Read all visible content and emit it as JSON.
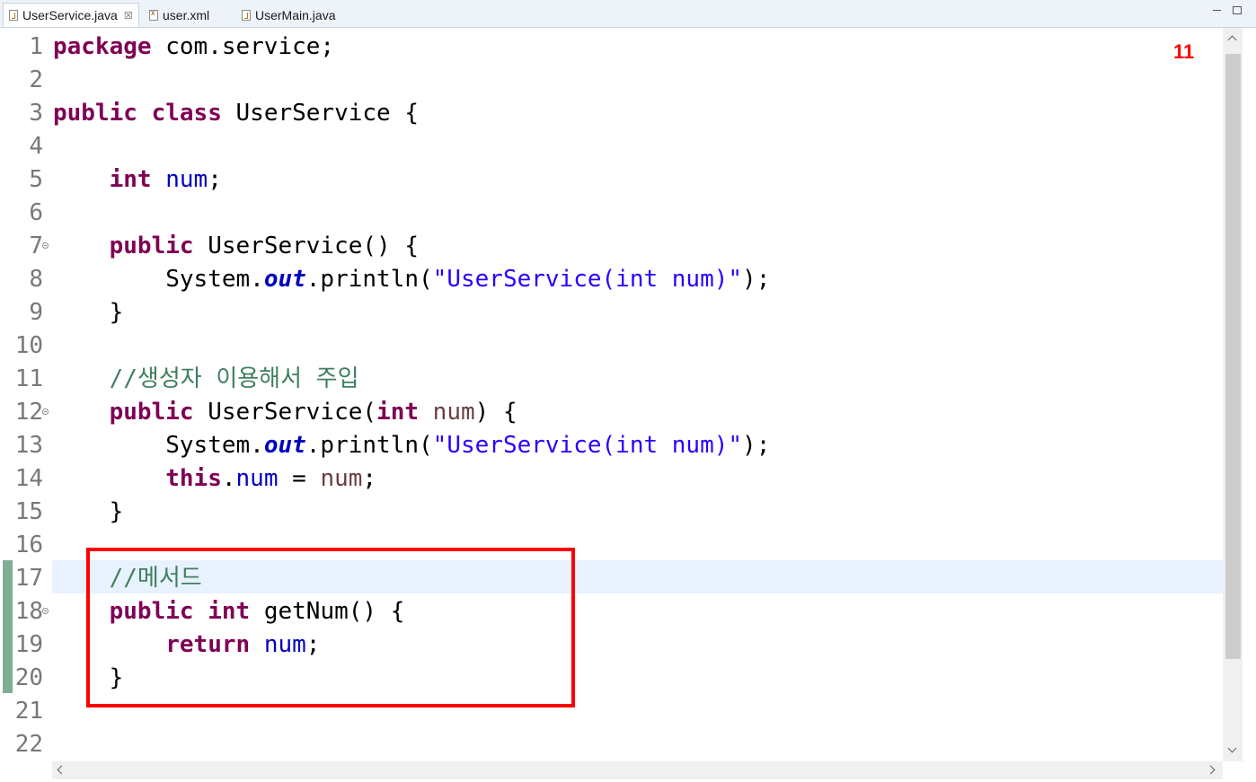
{
  "tabs": [
    {
      "label": "UserService.java",
      "icon": "java-file-icon",
      "active": true,
      "close": "☒"
    },
    {
      "label": "user.xml",
      "icon": "xml-file-icon",
      "active": false
    },
    {
      "label": "UserMain.java",
      "icon": "java-file-icon",
      "active": false
    }
  ],
  "line_numbers": [
    "1",
    "2",
    "3",
    "4",
    "5",
    "6",
    "7",
    "8",
    "9",
    "10",
    "11",
    "12",
    "13",
    "14",
    "15",
    "16",
    "17",
    "18",
    "19",
    "20",
    "21",
    "22"
  ],
  "code": {
    "l1": {
      "kw": "package",
      "rest": " com.service;"
    },
    "l3": {
      "kw1": "public",
      "kw2": "class",
      "rest": " UserService {"
    },
    "l5": {
      "kw": "int",
      "field": "num",
      "semi": ";"
    },
    "l7": {
      "kw": "public",
      "rest": " UserService() {"
    },
    "l8": {
      "sys": "System.",
      "out": "out",
      "println": ".println(",
      "str": "\"UserService(int num)\"",
      "end": ");"
    },
    "l9": {
      "brace": "}"
    },
    "l11": {
      "comment": "//생성자 이용해서 주입"
    },
    "l12": {
      "kw": "public",
      "mid": " UserService(",
      "kw2": "int",
      "param": "num",
      "end": ") {"
    },
    "l13": {
      "sys": "System.",
      "out": "out",
      "println": ".println(",
      "str": "\"UserService(int num)\"",
      "end": ");"
    },
    "l14": {
      "kw": "this",
      "dot": ".",
      "field": "num",
      "eq": " = ",
      "param": "num",
      "semi": ";"
    },
    "l15": {
      "brace": "}"
    },
    "l17": {
      "comment": "//메서드"
    },
    "l18": {
      "kw": "public",
      "kw2": "int",
      "rest": " getNum() {"
    },
    "l19": {
      "kw": "return",
      "field": "num",
      "semi": ";"
    },
    "l20": {
      "brace": "}"
    }
  },
  "annotation": "11",
  "colors": {
    "keyword": "#7f0055",
    "field": "#0000c0",
    "string": "#2a00ff",
    "comment": "#3f7f5f",
    "highlight_box": "#ff0000",
    "current_line": "#e8f2fe"
  }
}
